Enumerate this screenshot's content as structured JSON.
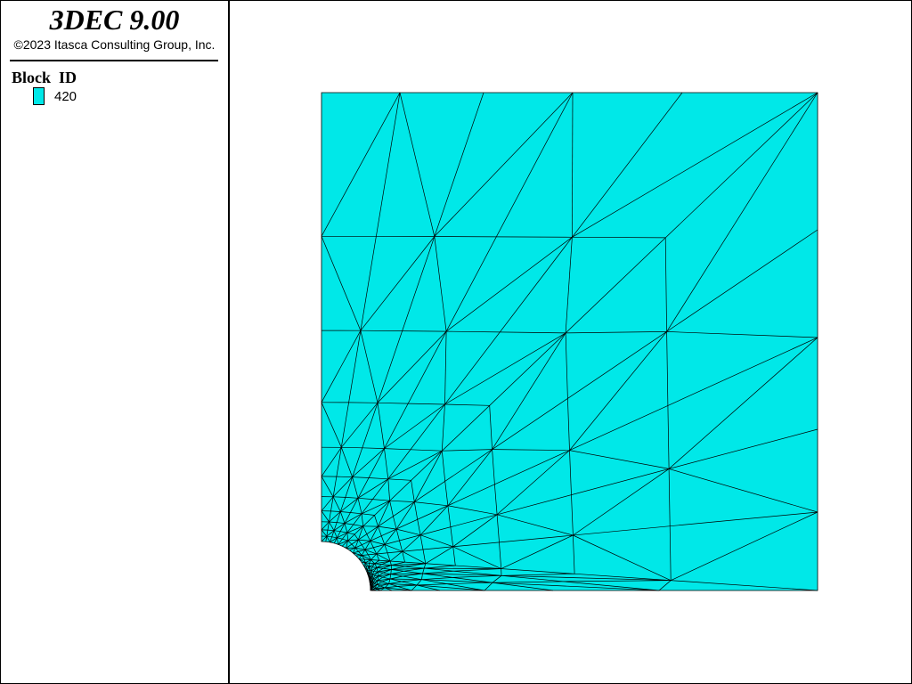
{
  "header": {
    "title": "3DEC 9.00",
    "copyright": "©2023 Itasca Consulting Group, Inc."
  },
  "legend": {
    "title": "Block  ID",
    "items": [
      {
        "label": "420",
        "color": "#00e8e8"
      }
    ]
  },
  "plot": {
    "fill_color": "#00e8e8",
    "line_color": "#000000"
  }
}
